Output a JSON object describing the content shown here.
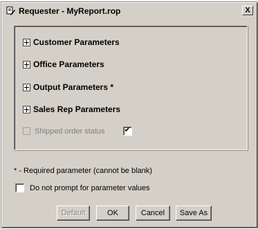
{
  "window": {
    "title": "Requester - MyReport.rop",
    "title_icon": "requester-app-icon",
    "close_label": "X"
  },
  "groups": [
    {
      "label": "Customer Parameters"
    },
    {
      "label": "Office Parameters"
    },
    {
      "label": "Output Parameters *"
    },
    {
      "label": "Sales Rep Parameters"
    }
  ],
  "shipped": {
    "label": "Shipped order status",
    "checked": true,
    "check_glyph": "✔"
  },
  "note": "* - Required parameter (cannot be blank)",
  "no_prompt": {
    "label": "Do not prompt for parameter values",
    "checked": false
  },
  "buttons": {
    "default": "Default",
    "ok": "OK",
    "cancel": "Cancel",
    "save_as": "Save As"
  },
  "colors": {
    "face": "#d4d0c8",
    "shadow": "#808080",
    "disabled_text": "#808080"
  }
}
